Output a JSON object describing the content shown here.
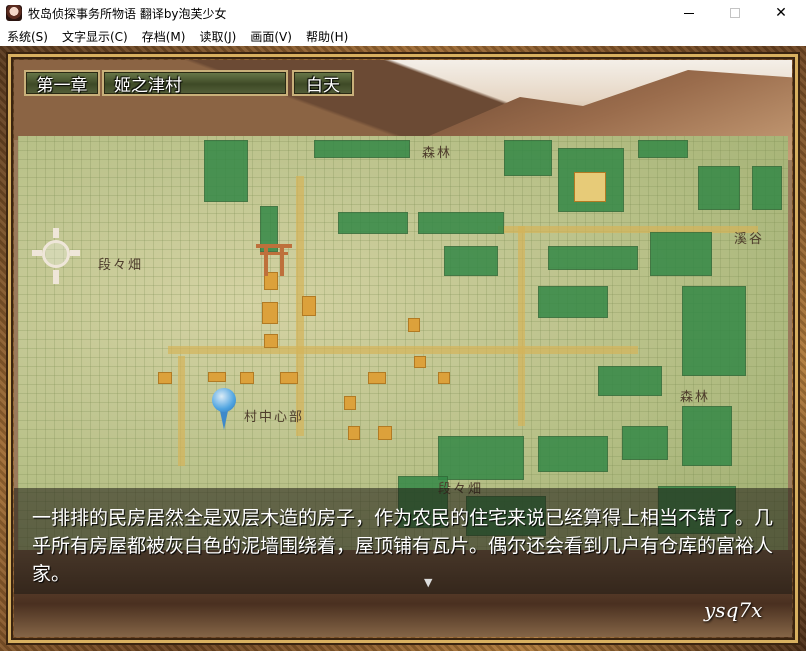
{
  "window": {
    "title": "牧岛侦探事务所物语  翻译by泡芙少女",
    "minimize": "–",
    "maximize": "□",
    "close": "✕"
  },
  "menu": [
    {
      "label": "系统(S)"
    },
    {
      "label": "文字显示(C)"
    },
    {
      "label": "存档(M)"
    },
    {
      "label": "读取(J)"
    },
    {
      "label": "画面(V)"
    },
    {
      "label": "帮助(H)"
    }
  ],
  "header": {
    "chapter": "第一章",
    "location": "姬之津村",
    "time_of_day": "白天"
  },
  "map": {
    "labels": {
      "forest_north": "森林",
      "valley": "溪谷",
      "field_west": "段々畑",
      "village_center": "村中心部",
      "forest_east": "森林",
      "field_south": "段々畑"
    },
    "icons": [
      "torii-icon",
      "compass-icon",
      "location-pin-icon"
    ]
  },
  "dialogue": {
    "text": "一排排的民房居然全是双层木造的房子，作为农民的住宅来说已经算得上相当不错了。几乎所有房屋都被灰白色的泥墙围绕着，屋顶铺有瓦片。偶尔还会看到几户有仓库的富裕人家。",
    "next_indicator": "▼"
  },
  "watermark": "ysq7x",
  "colors": {
    "map_block": "#2f8a46",
    "building": "#e0a43a",
    "frame": "#a06c34",
    "plate": "#3e4a26"
  }
}
